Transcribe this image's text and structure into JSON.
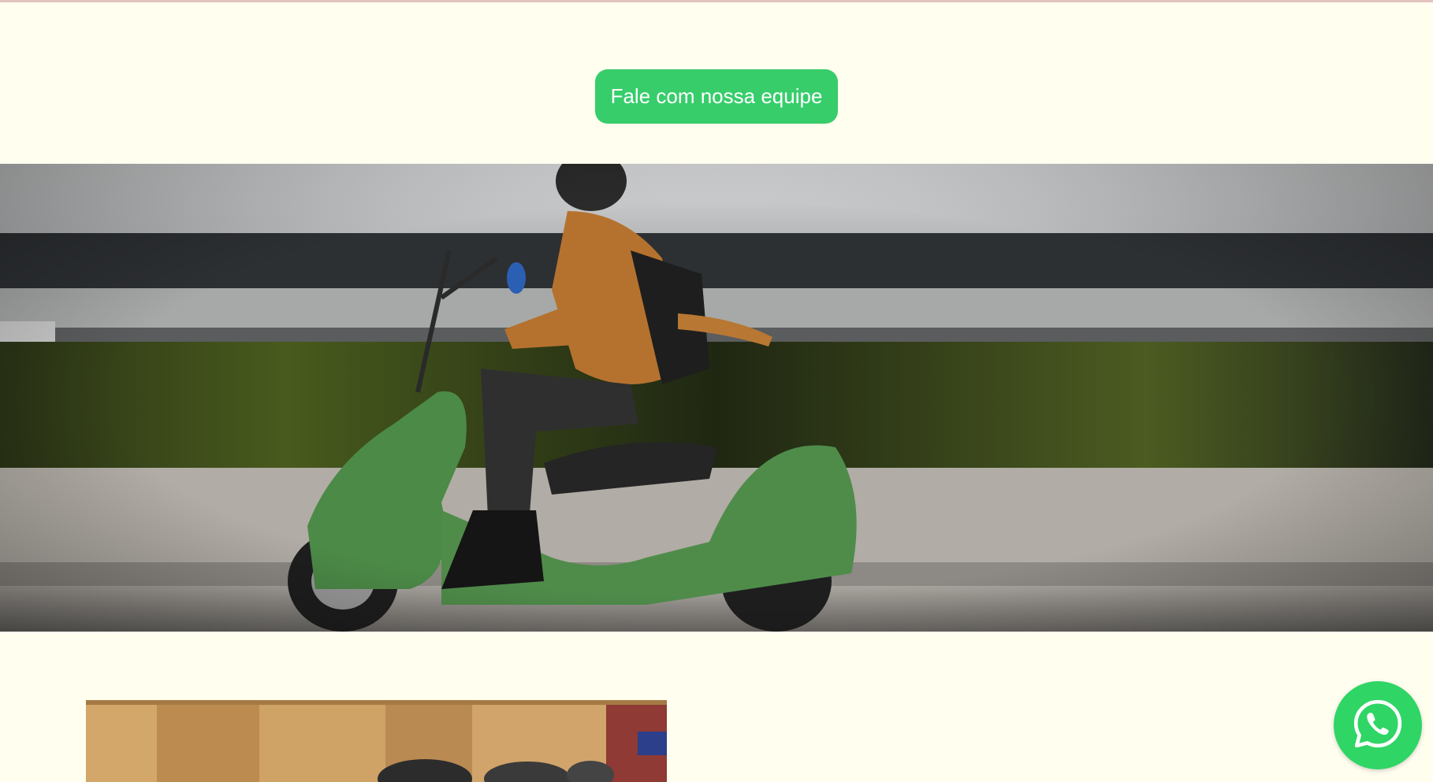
{
  "cta": {
    "label": "Fale com nossa equipe"
  },
  "colors": {
    "page_background": "#fffeef",
    "accent": "#37cd6b",
    "whatsapp": "#2fd565",
    "top_rule": "#e4c3bf"
  },
  "hero_image": {
    "subject": "woman riding green electric scooter"
  },
  "secondary_image": {
    "subject": "scooters among cardboard boxes in warehouse"
  },
  "floating_button": {
    "icon": "whatsapp-icon"
  }
}
